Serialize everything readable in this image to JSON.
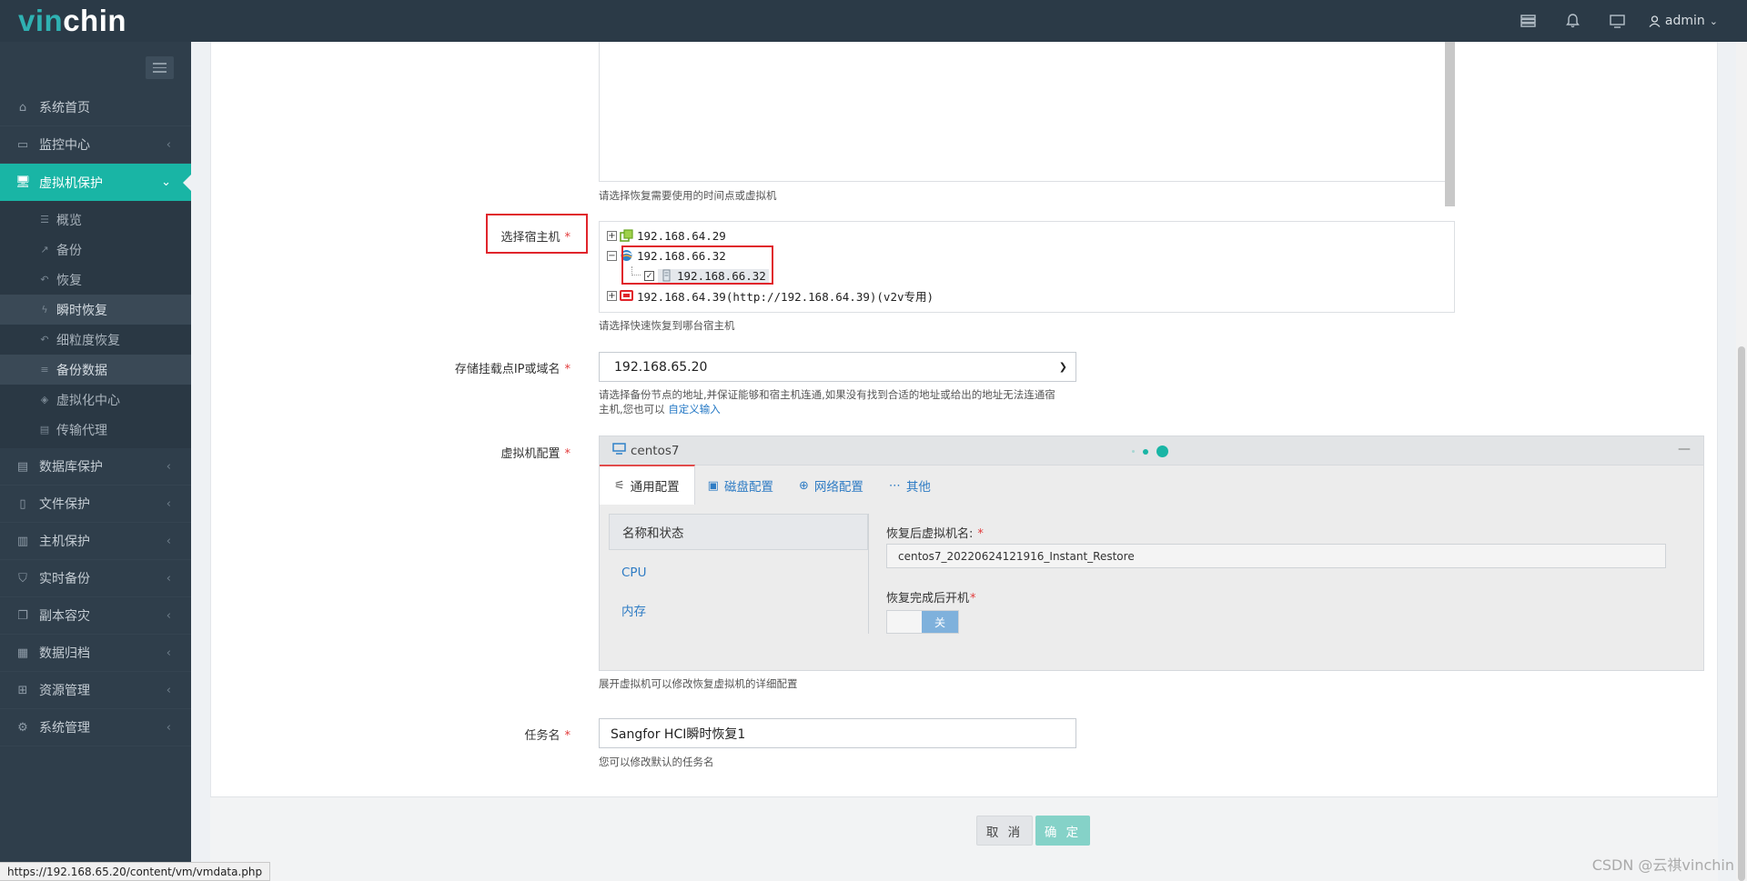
{
  "header": {
    "logo_prefix": "vin",
    "logo_rest": "chin",
    "user": "admin"
  },
  "sidebar": {
    "items": [
      {
        "label": "系统首页",
        "icon": "home-icon"
      },
      {
        "label": "监控中心",
        "icon": "monitor-icon"
      },
      {
        "label": "虚拟机保护",
        "icon": "desktop-icon",
        "active": true
      },
      {
        "label": "数据库保护",
        "icon": "database-icon"
      },
      {
        "label": "文件保护",
        "icon": "file-icon"
      },
      {
        "label": "主机保护",
        "icon": "server-icon"
      },
      {
        "label": "实时备份",
        "icon": "shield-icon"
      },
      {
        "label": "副本容灾",
        "icon": "copy-icon"
      },
      {
        "label": "数据归档",
        "icon": "archive-icon"
      },
      {
        "label": "资源管理",
        "icon": "grid-icon"
      },
      {
        "label": "系统管理",
        "icon": "gear-icon"
      }
    ],
    "sub_items": [
      {
        "label": "概览"
      },
      {
        "label": "备份"
      },
      {
        "label": "恢复"
      },
      {
        "label": "瞬时恢复"
      },
      {
        "label": "细粒度恢复"
      },
      {
        "label": "备份数据"
      },
      {
        "label": "虚拟化中心"
      },
      {
        "label": "传输代理"
      }
    ]
  },
  "form": {
    "restore_point_help": "请选择恢复需要使用的时间点或虚拟机",
    "host_label": "选择宿主机",
    "host_tree": [
      "192.168.64.29",
      "192.168.66.32",
      "192.168.66.32",
      "192.168.64.39(http://192.168.64.39)(v2v专用)"
    ],
    "host_help": "请选择快速恢复到哪台宿主机",
    "storage_label": "存储挂载点IP或域名",
    "storage_value": "192.168.65.20",
    "storage_help_1": "请选择备份节点的地址,并保证能够和宿主机连通,如果没有找到合适的地址或给出的地址无法连通宿",
    "storage_help_2": "主机,您也可以",
    "storage_help_link": "自定义输入",
    "vmconfig_label": "虚拟机配置",
    "vm_name": "centos7",
    "tabs": [
      "通用配置",
      "磁盘配置",
      "网络配置",
      "其他"
    ],
    "left_nav": [
      "名称和状态",
      "CPU",
      "内存"
    ],
    "restore_name_label": "恢复后虚拟机名:",
    "restore_name_value": "centos7_20220624121916_Instant_Restore",
    "power_on_label": "恢复完成后开机",
    "power_on_state": "关",
    "vmconfig_help": "展开虚拟机可以修改恢复虚拟机的详细配置",
    "task_label": "任务名",
    "task_value": "Sangfor HCI瞬时恢复1",
    "task_help": "您可以修改默认的任务名"
  },
  "buttons": {
    "cancel": "取 消",
    "ok": "确 定"
  },
  "status_url": "https://192.168.65.20/content/vm/vmdata.php",
  "watermark": "CSDN @云祺vinchin",
  "colors": {
    "header": "#2b3a47",
    "sidebar": "#2f3e4b",
    "accent": "#19b5a5",
    "link": "#2f7cc4",
    "highlight_red": "#e0242b"
  }
}
